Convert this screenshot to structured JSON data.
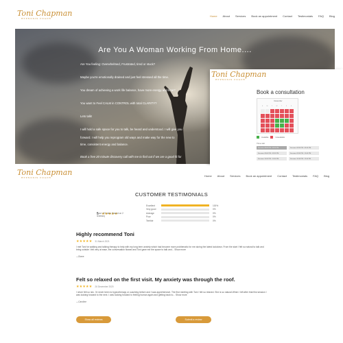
{
  "brand": {
    "name": "Toni Chapman",
    "tagline": "HYPNOSIS COACH"
  },
  "nav": {
    "items": [
      "Home",
      "About",
      "Services",
      "Book an appointment",
      "Contact",
      "Testimonials",
      "FAQ",
      "Blog"
    ]
  },
  "hero": {
    "title": "Are You A Woman Working From Home....",
    "lines": [
      "Are You feeling: Overwhelmed, Frustrated, tired or stuck?",
      "Maybe you're emotionally drained and just feel stressed all the time.",
      "You dream of achieving a work life balance, have more energy and time?",
      "You want to Feel CALM in CONTROL with total CLARITY?",
      "Lets talk!",
      "I  will hold a safe space for you to talk, be heard and understood. I will give you",
      "forward. I will help you reprogram old ways and make way for the new to",
      "time, consistent energy and balance.",
      "Book a free 20 minute discovery call with me to find out if we are a good fit for"
    ]
  },
  "consultation": {
    "title": "Book a consultation",
    "calendar_title": "December",
    "weekday_headers": [
      "S",
      "M",
      "T",
      "W",
      "T",
      "F",
      "S"
    ],
    "legend_available": "Available",
    "legend_unavailable": "Unavailable",
    "timeslot_label": "Time slot",
    "slots": [
      "Sessions 08:00 PM - 08:30 PM",
      "Sessions 08:30 PM - 09:00 PM",
      "Sessions 09:00 PM - 09:30 PM",
      "Sessions 09:30 PM - 10:00 PM",
      "Sessions 10:00 PM - 10:30 PM",
      "Sessions 10:30 PM - 11:00 PM"
    ],
    "selected_slot_index": 0,
    "colors": {
      "available": "#48b14a",
      "unavailable": "#e4505a"
    }
  },
  "testimonials": {
    "title": "CUSTOMER TESTIMONIALS",
    "score": "5",
    "stars": "★★★★★",
    "summary": "5 out of 5 stars (based on 2 reviews)",
    "breakdown": [
      {
        "label": "Excellent",
        "percent": 100,
        "text": "100%"
      },
      {
        "label": "Very good",
        "percent": 0,
        "text": "0%"
      },
      {
        "label": "Average",
        "percent": 0,
        "text": "0%"
      },
      {
        "label": "Poor",
        "percent": 0,
        "text": "0%"
      },
      {
        "label": "Terrible",
        "percent": 0,
        "text": "0%"
      }
    ],
    "reviews": [
      {
        "title": "Highly recommend Toni",
        "stars": "★★★★★",
        "date": "31 March 2021",
        "body": "I met Toni for walking and talking therapy to help with my long term anxiety which had become more problematic for me during the latest lockdown. From the start I felt so natural to talk and bring outside I felt very at ease, the conversation flowed and Toni gave me the space to talk and... Show more",
        "author": "—Diane"
      },
      {
        "title": "Felt so relaxed on the first visit. My anxiety was through the roof.",
        "stars": "★★★★★",
        "date": "26 December 2020",
        "body": "I never felt so nec. I'd never been to hypnotherapy or coaching before and I was apprehensive. The first meeting with Toni I felt so relaxed. She is so natural.When I left after that first session I was looking forward to the next. I was looking forward to feeling human again and getting back to... Show more",
        "author": "—Caroline"
      }
    ],
    "show_all_label": "Show all reviews",
    "submit_label": "Submit a review"
  },
  "accent_color": "#c98f34"
}
